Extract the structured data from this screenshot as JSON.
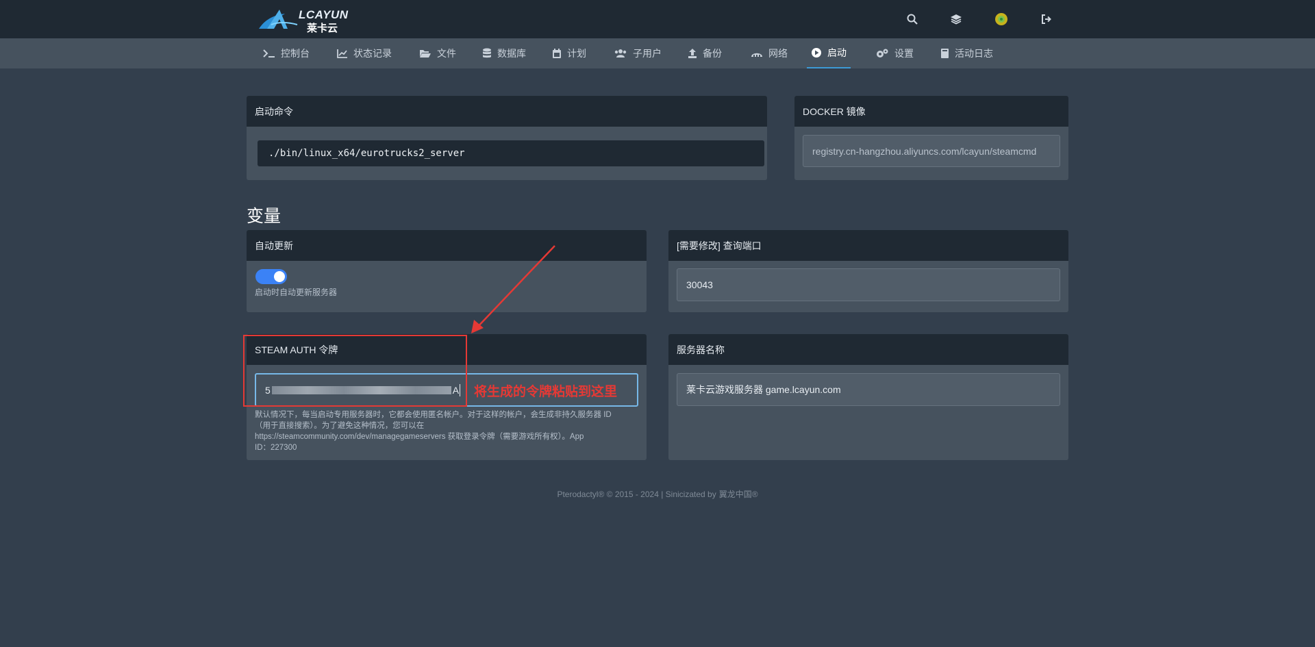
{
  "brand": {
    "name_en": "LCAYUN",
    "name_cn": "莱卡云"
  },
  "nav": [
    {
      "label": "控制台",
      "icon": "terminal-icon"
    },
    {
      "label": "状态记录",
      "icon": "chart-line-icon"
    },
    {
      "label": "文件",
      "icon": "folder-open-icon"
    },
    {
      "label": "数据库",
      "icon": "database-icon"
    },
    {
      "label": "计划",
      "icon": "calendar-icon"
    },
    {
      "label": "子用户",
      "icon": "users-icon"
    },
    {
      "label": "备份",
      "icon": "upload-icon"
    },
    {
      "label": "网络",
      "icon": "network-icon"
    },
    {
      "label": "启动",
      "icon": "play-circle-icon",
      "active": true
    },
    {
      "label": "设置",
      "icon": "cogs-icon"
    },
    {
      "label": "活动日志",
      "icon": "book-icon"
    }
  ],
  "startup": {
    "command_title": "启动命令",
    "command": "./bin/linux_x64/eurotrucks2_server",
    "docker_title": "DOCKER 镜像",
    "docker_image": "registry.cn-hangzhou.aliyuncs.com/lcayun/steamcmd"
  },
  "variables": {
    "title": "变量",
    "auto_update": {
      "title": "自动更新",
      "enabled": true,
      "help": "启动时自动更新服务器"
    },
    "query_port": {
      "title": "[需要修改] 查询端口",
      "value": "30043"
    },
    "steam_auth": {
      "title": "STEAM AUTH 令牌",
      "value_start": "5",
      "value_end": "A",
      "help_lines": [
        "默认情况下，每当启动专用服务器时，它都会使用匿名帐户。对于这样的帐户，会生成非持久服务器 ID",
        "（用于直接搜索）。为了避免这种情况，您可以在",
        "https://steamcommunity.com/dev/managegameservers 获取登录令牌（需要游戏所有权）。App",
        "ID：227300"
      ]
    },
    "server_name": {
      "title": "服务器名称",
      "value": "莱卡云游戏服务器 game.lcayun.com"
    }
  },
  "annotation": {
    "text": "将生成的令牌粘贴到这里",
    "color": "#e53935"
  },
  "footer": {
    "text": "Pterodactyl® © 2015 - 2024 | Sinicizated by",
    "cn": "翼龙中国®"
  },
  "colors": {
    "accent": "#3b82f6",
    "header_bg": "#1f2933",
    "card_bg": "#46525e",
    "page_bg": "#333f4d"
  }
}
